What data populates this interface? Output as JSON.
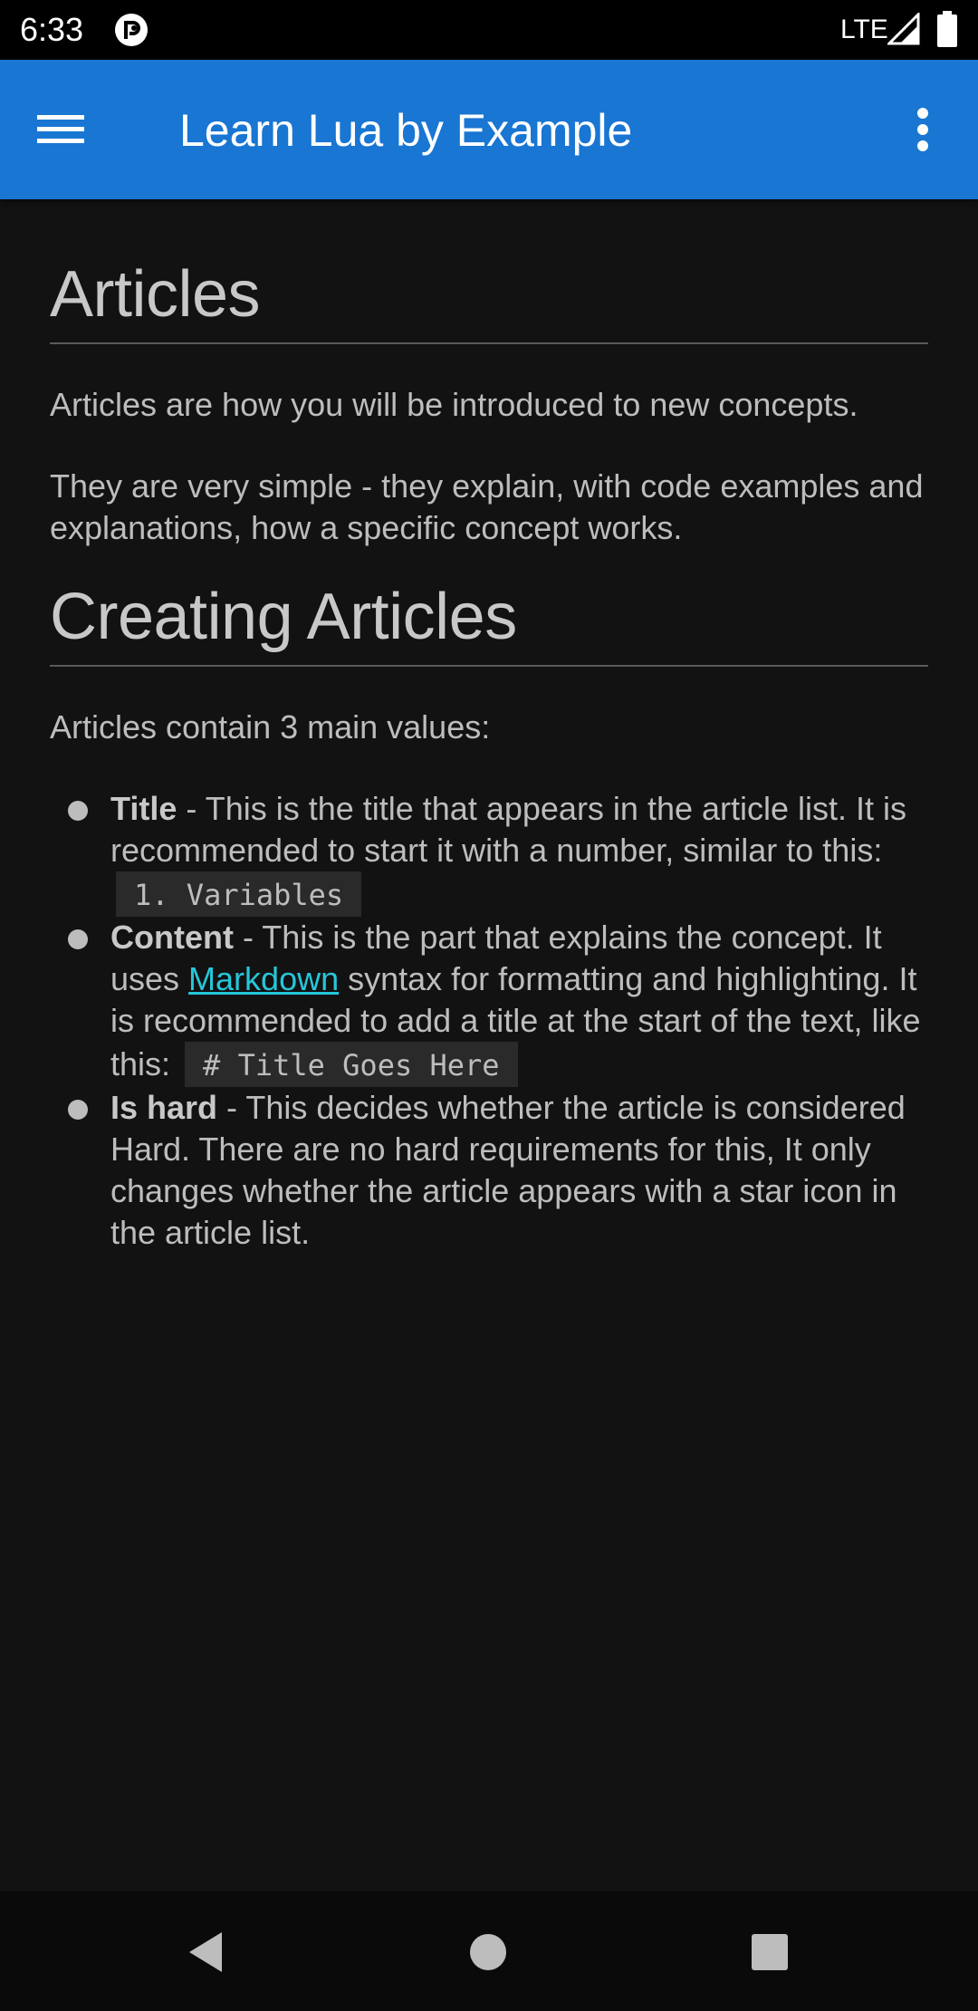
{
  "status_bar": {
    "time": "6:33",
    "network": "LTE",
    "icons": [
      "app-notification-icon",
      "signal-icon",
      "battery-icon"
    ]
  },
  "app_bar": {
    "title": "Learn Lua by Example",
    "menu_icon": "hamburger-menu-icon",
    "overflow_icon": "more-vert-icon",
    "color": "#1976d2"
  },
  "content": {
    "heading_articles": "Articles",
    "intro_p1": "Articles are how you will be introduced to new concepts.",
    "intro_p2": "They are very simple - they explain, with code examples and explanations, how a specific concept works.",
    "heading_creating": "Creating Articles",
    "values_intro": "Articles contain 3 main values:",
    "items": [
      {
        "term": "Title",
        "text": " - This is the title that appears in the article list. It is recommended to start it with a number, similar to this: ",
        "code": "1. Variables"
      },
      {
        "term": "Content",
        "text_before_link": " - This is the part that explains the concept. It uses ",
        "link": "Markdown",
        "text_after_link": " syntax for formatting and highlighting. It is recommended to add a title at the start of the text, like this: ",
        "code": "# Title Goes Here"
      },
      {
        "term": "Is hard",
        "text": " - This decides whether the article is considered Hard. There are no hard requirements for this, It only changes whether the article appears with a star icon in the article list."
      }
    ],
    "link_color": "#26c6da"
  },
  "nav_bar": {
    "icons": [
      "back-icon",
      "home-icon",
      "recents-icon"
    ]
  }
}
